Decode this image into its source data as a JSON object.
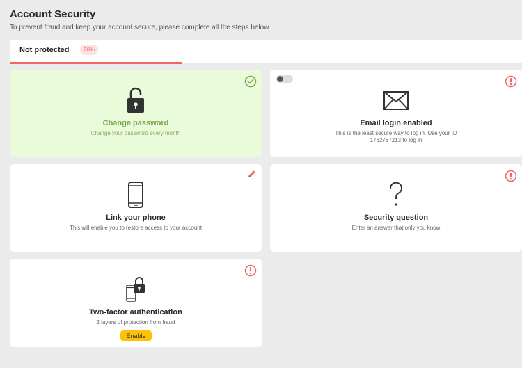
{
  "header": {
    "title": "Account Security",
    "subtitle": "To prevent fraud and keep your account secure, please complete all the steps below"
  },
  "status": {
    "label": "Not protected",
    "badge": "20%",
    "progress_fraction": 0.2
  },
  "cards": {
    "change_password": {
      "title": "Change password",
      "description": "Change your password every month",
      "icon": "unlocked-padlock-icon",
      "status_icon": "check-circle-icon",
      "state": "completed"
    },
    "email_login": {
      "title": "Email login enabled",
      "description": "This is the least secure way to log in. Use your ID 1762787213 to log in",
      "icon": "envelope-icon",
      "status_icon": "warning-circle-icon",
      "toggle_state": "off"
    },
    "link_phone": {
      "title": "Link your phone",
      "description": "This will enable you to restore access to your account",
      "icon": "smartphone-icon",
      "status_icon": "pencil-icon"
    },
    "security_question": {
      "title": "Security question",
      "description": "Enter an answer that only you know",
      "icon": "question-mark-icon",
      "status_icon": "warning-circle-icon"
    },
    "two_factor": {
      "title": "Two-factor authentication",
      "description": "2 layers of protection from fraud",
      "icon": "phone-with-padlock-icon",
      "status_icon": "warning-circle-icon",
      "button_label": "Enable"
    }
  },
  "colors": {
    "completed_bg": "#eafbdc",
    "completed_text": "#7aa64a",
    "warning": "#f06464",
    "progress": "#f06464",
    "button": "#ffc107"
  }
}
